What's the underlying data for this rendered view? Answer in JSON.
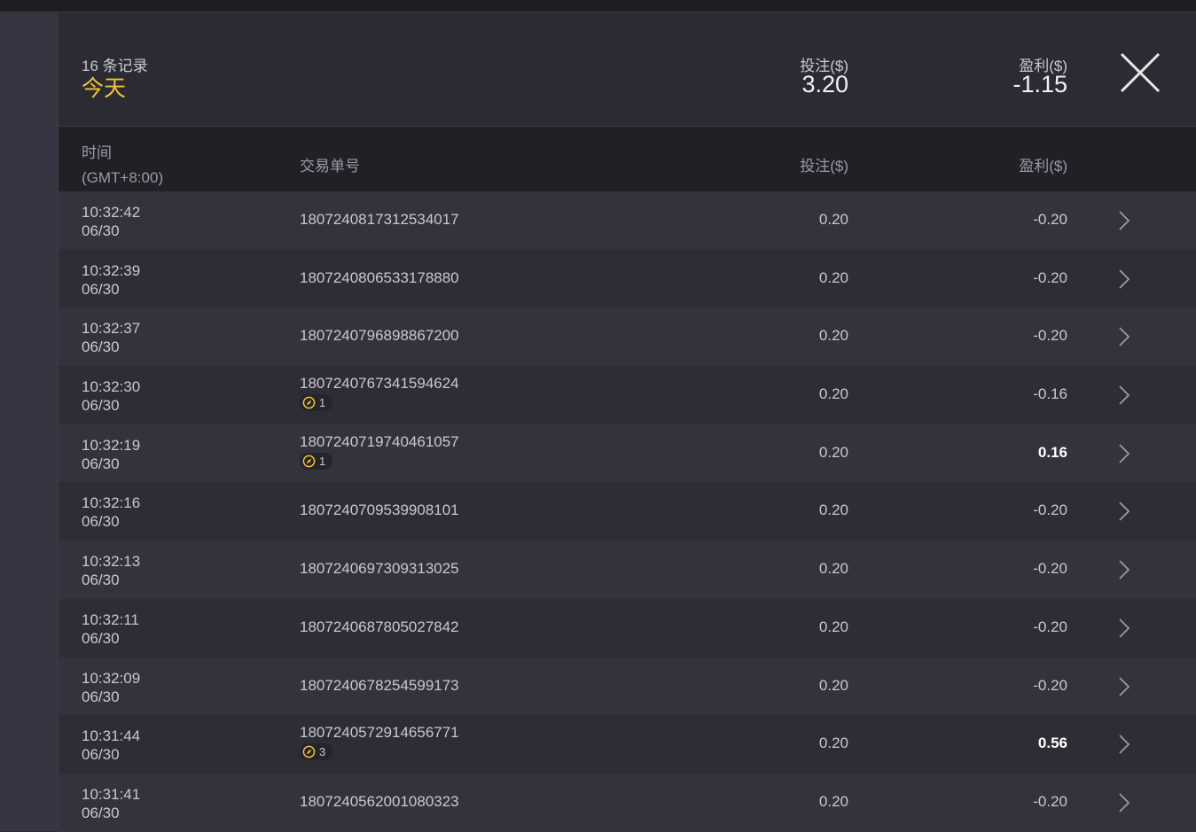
{
  "summary": {
    "record_count": "16 条记录",
    "period": "今天",
    "bet_label": "投注($)",
    "bet_total": "3.20",
    "profit_label": "盈利($)",
    "profit_total": "-1.15",
    "close_icon": "close-icon"
  },
  "table": {
    "headers": {
      "time": "时间",
      "timezone": "(GMT+8:00)",
      "order": "交易单号",
      "bet": "投注($)",
      "profit": "盈利($)"
    },
    "rows": [
      {
        "time": "10:32:42",
        "date": "06/30",
        "order": "1807240817312534017",
        "badge": "",
        "bet": "0.20",
        "profit": "-0.20"
      },
      {
        "time": "10:32:39",
        "date": "06/30",
        "order": "1807240806533178880",
        "badge": "",
        "bet": "0.20",
        "profit": "-0.20"
      },
      {
        "time": "10:32:37",
        "date": "06/30",
        "order": "1807240796898867200",
        "badge": "",
        "bet": "0.20",
        "profit": "-0.20"
      },
      {
        "time": "10:32:30",
        "date": "06/30",
        "order": "1807240767341594624",
        "badge": "1",
        "bet": "0.20",
        "profit": "-0.16"
      },
      {
        "time": "10:32:19",
        "date": "06/30",
        "order": "1807240719740461057",
        "badge": "1",
        "bet": "0.20",
        "profit": "0.16"
      },
      {
        "time": "10:32:16",
        "date": "06/30",
        "order": "1807240709539908101",
        "badge": "",
        "bet": "0.20",
        "profit": "-0.20"
      },
      {
        "time": "10:32:13",
        "date": "06/30",
        "order": "1807240697309313025",
        "badge": "",
        "bet": "0.20",
        "profit": "-0.20"
      },
      {
        "time": "10:32:11",
        "date": "06/30",
        "order": "1807240687805027842",
        "badge": "",
        "bet": "0.20",
        "profit": "-0.20"
      },
      {
        "time": "10:32:09",
        "date": "06/30",
        "order": "1807240678254599173",
        "badge": "",
        "bet": "0.20",
        "profit": "-0.20"
      },
      {
        "time": "10:31:44",
        "date": "06/30",
        "order": "1807240572914656771",
        "badge": "3",
        "bet": "0.20",
        "profit": "0.56"
      },
      {
        "time": "10:31:41",
        "date": "06/30",
        "order": "1807240562001080323",
        "badge": "",
        "bet": "0.20",
        "profit": "-0.20"
      }
    ]
  },
  "colors": {
    "accent": "#f4c331",
    "background": "#2b2b34",
    "header_bg": "#202027"
  }
}
